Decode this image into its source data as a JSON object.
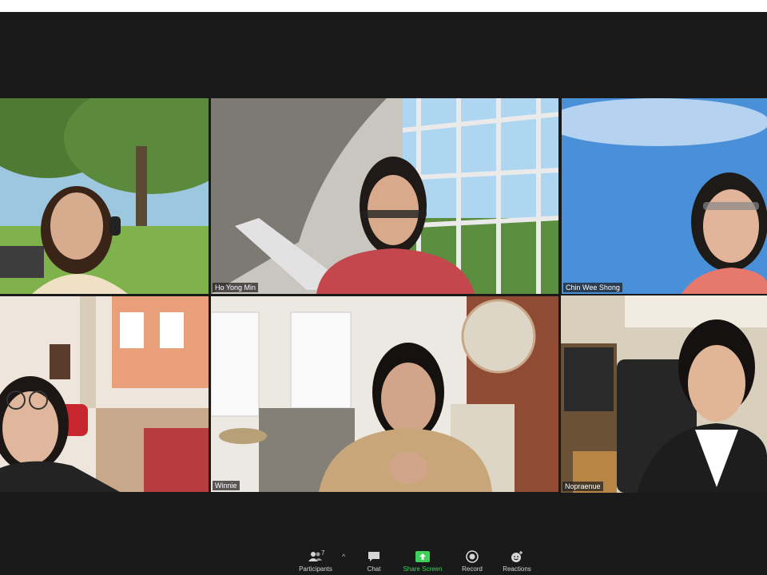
{
  "participants": [
    {
      "name": ""
    },
    {
      "name": "Ho Yong Min"
    },
    {
      "name": "Chin Wee Shong"
    },
    {
      "name": ""
    },
    {
      "name": "Winnie"
    },
    {
      "name": "Nopraenue",
      "active": true
    }
  ],
  "toolbar": {
    "participants_label": "Participants",
    "participants_count": "7",
    "caret": "^",
    "chat_label": "Chat",
    "share_label": "Share Screen",
    "record_label": "Record",
    "reactions_label": "Reactions"
  },
  "colors": {
    "active_border": "#e6e84e",
    "share_green": "#3ed15a",
    "background": "#1a1a1a"
  },
  "icons": [
    "participants-icon",
    "chevron-up-icon",
    "chat-icon",
    "share-screen-icon",
    "record-icon",
    "reactions-icon"
  ]
}
